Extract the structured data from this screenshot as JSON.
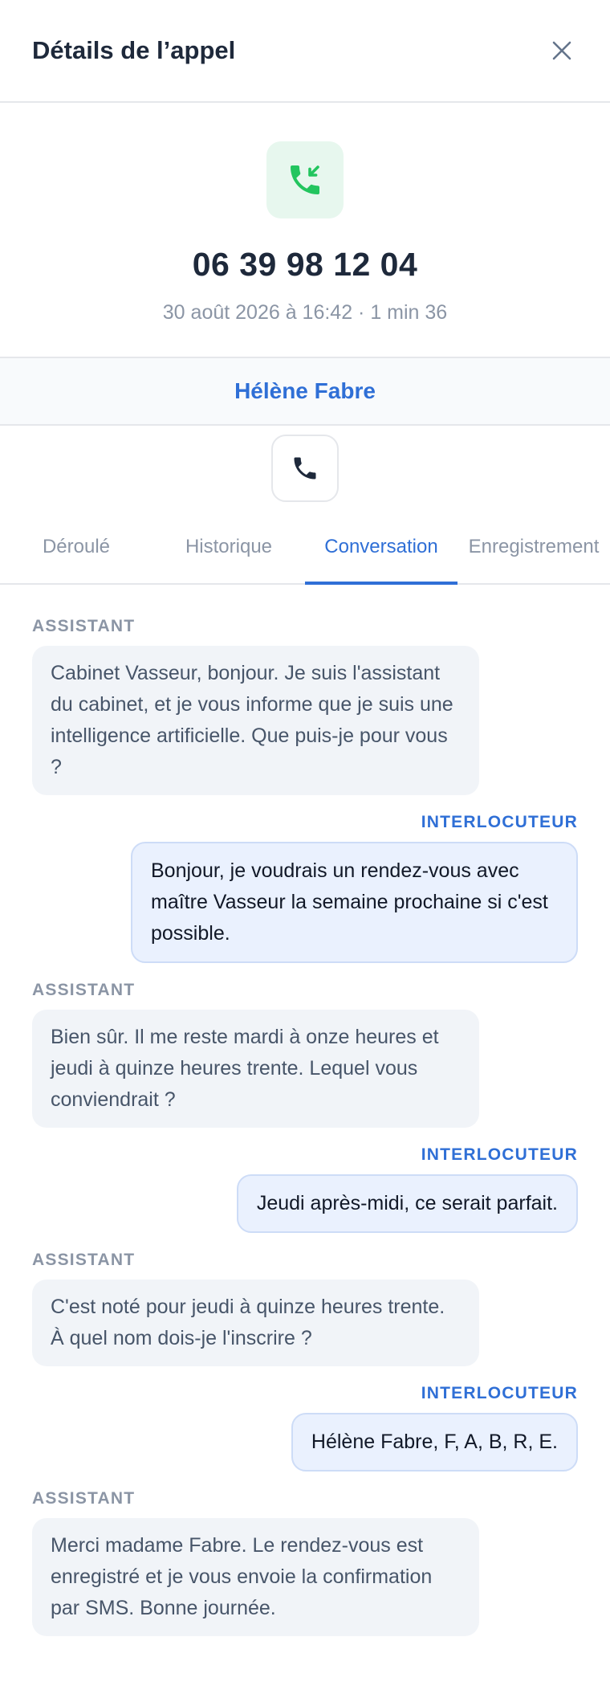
{
  "header": {
    "title": "Détails de l’appel",
    "close_icon": "close-icon"
  },
  "call": {
    "icon": "incoming-call-icon",
    "number": "06 39 98 12 04",
    "meta": "30 août 2026 à 16:42 · 1 min 36",
    "contact_name": "Hélène Fabre",
    "action_icon": "phone-icon"
  },
  "tabs": [
    {
      "label": "Déroulé",
      "active": false
    },
    {
      "label": "Historique",
      "active": false
    },
    {
      "label": "Conversation",
      "active": true
    },
    {
      "label": "Enregistrement",
      "active": false
    }
  ],
  "conversation": {
    "messages": [
      {
        "role": "ASSISTANT",
        "text": "Cabinet Vasseur, bonjour. Je suis l'assistant du cabinet, et je vous informe que je suis une intelligence artificielle. Que puis-je pour vous ?"
      },
      {
        "role": "INTERLOCUTEUR",
        "text": "Bonjour, je voudrais un rendez-vous avec maître Vasseur la semaine prochaine si c'est possible."
      },
      {
        "role": "ASSISTANT",
        "text": "Bien sûr. Il me reste mardi à onze heures et jeudi à quinze heures trente. Lequel vous conviendrait ?"
      },
      {
        "role": "INTERLOCUTEUR",
        "text": "Jeudi après-midi, ce serait parfait."
      },
      {
        "role": "ASSISTANT",
        "text": "C'est noté pour jeudi à quinze heures trente. À quel nom dois-je l'inscrire ?"
      },
      {
        "role": "INTERLOCUTEUR",
        "text": "Hélène Fabre, F, A, B, R, E."
      },
      {
        "role": "ASSISTANT",
        "text": "Merci madame Fabre. Le rendez-vous est enregistré et je vous envoie la confirmation par SMS. Bonne journée."
      }
    ]
  },
  "colors": {
    "accent": "#2f6fd6",
    "call_green": "#22c55e",
    "call_green_bg": "#e7f7ee",
    "assistant_bubble": "#f1f4f8",
    "user_bubble": "#eaf1fe"
  }
}
